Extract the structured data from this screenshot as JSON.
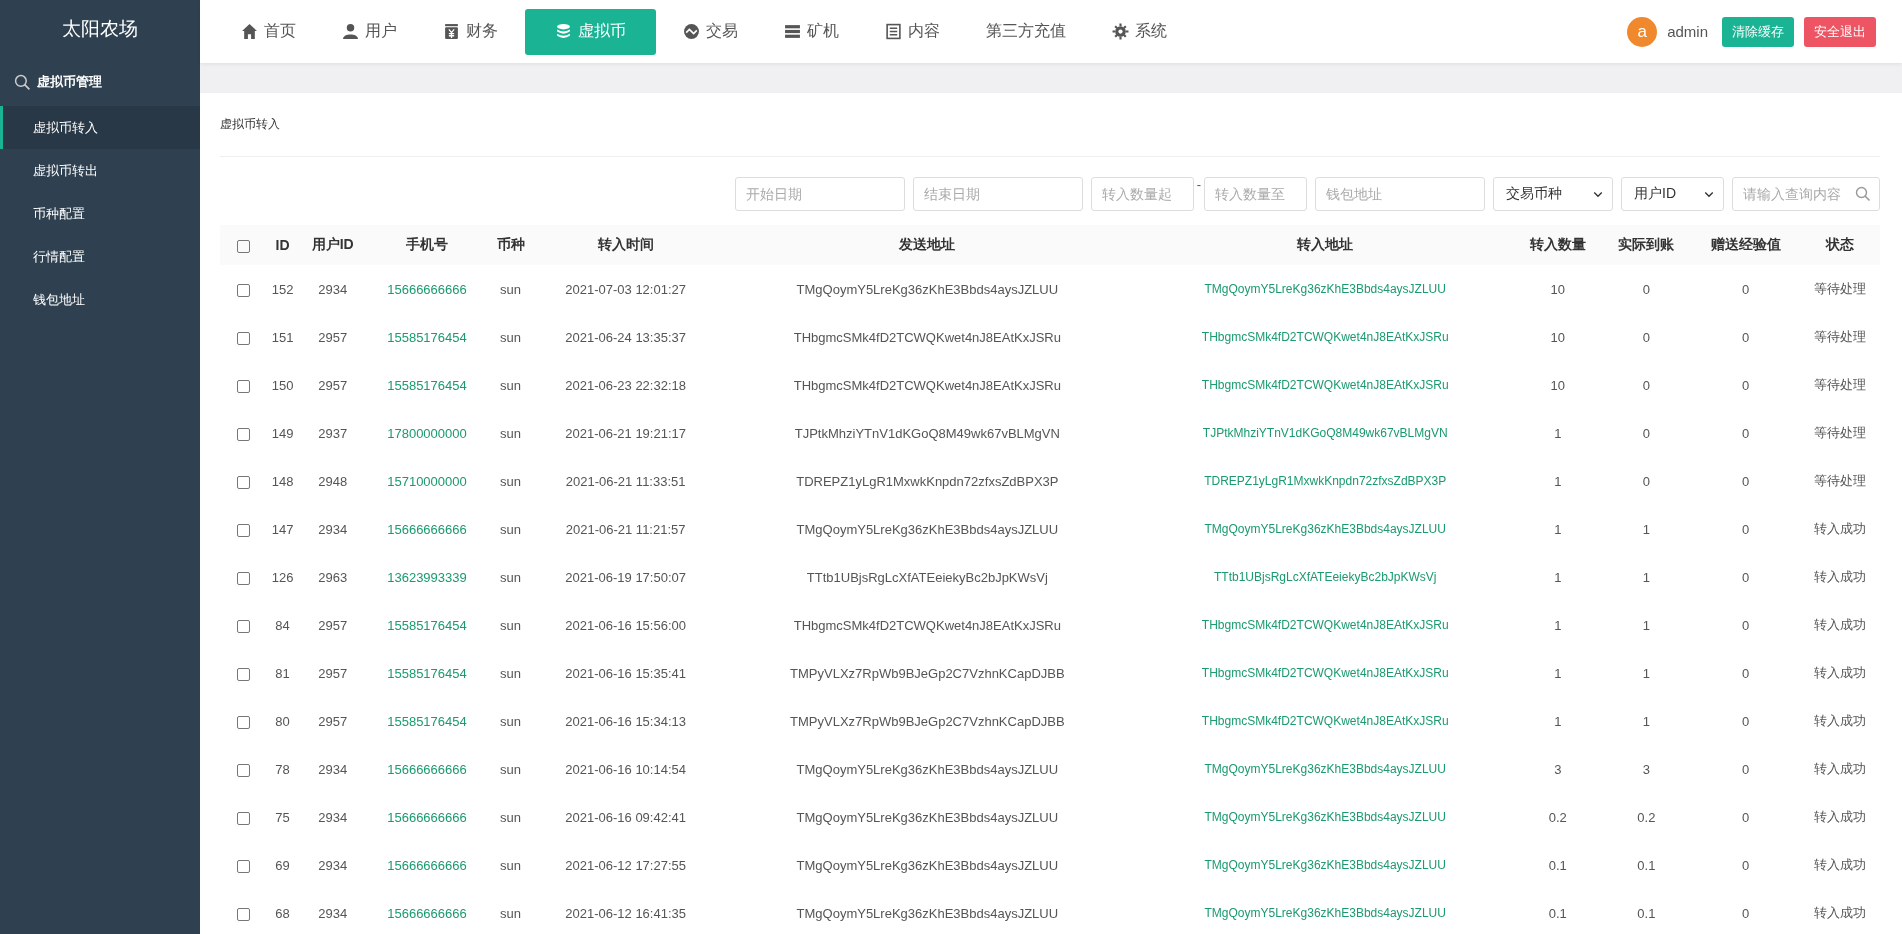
{
  "sidebar": {
    "brand": "太阳农场",
    "section": "虚拟币管理",
    "items": [
      {
        "label": "虚拟币转入",
        "selected": true
      },
      {
        "label": "虚拟币转出",
        "selected": false
      },
      {
        "label": "币种配置",
        "selected": false
      },
      {
        "label": "行情配置",
        "selected": false
      },
      {
        "label": "钱包地址",
        "selected": false
      }
    ]
  },
  "nav": {
    "items": [
      {
        "label": "首页",
        "selected": false
      },
      {
        "label": "用户",
        "selected": false
      },
      {
        "label": "财务",
        "selected": false
      },
      {
        "label": "虚拟币",
        "selected": true
      },
      {
        "label": "交易",
        "selected": false
      },
      {
        "label": "矿机",
        "selected": false
      },
      {
        "label": "内容",
        "selected": false
      },
      {
        "label": "第三方充值",
        "selected": false
      },
      {
        "label": "系统",
        "selected": false
      }
    ],
    "avatar": "a",
    "username": "admin",
    "buttons": [
      {
        "label": "清除缓存",
        "kind": "primary"
      },
      {
        "label": "安全退出",
        "kind": "danger"
      }
    ]
  },
  "panel": {
    "title": "虚拟币转入",
    "filters": [
      {
        "kind": "input",
        "placeholder": "开始日期"
      },
      {
        "kind": "input",
        "placeholder": "结束日期"
      },
      {
        "kind": "input",
        "placeholder": "转入数量起"
      },
      {
        "kind": "dash",
        "text": "-"
      },
      {
        "kind": "input",
        "placeholder": "转入数量至"
      },
      {
        "kind": "input",
        "placeholder": "钱包地址"
      },
      {
        "kind": "select",
        "value": "交易币种"
      },
      {
        "kind": "select",
        "value": "用户ID"
      },
      {
        "kind": "search",
        "placeholder": "请输入查询内容"
      }
    ],
    "table": {
      "all_checked": false,
      "columns": [
        "ID",
        "用户ID",
        "手机号",
        "币种",
        "转入时间",
        "发送地址",
        "转入地址",
        "转入数量",
        "实际到账",
        "赠送经验值",
        "状态"
      ],
      "rows": [
        {
          "checked": false,
          "cells": [
            "152",
            "2934",
            "15666666666",
            "sun",
            "2021-07-03 12:01:27",
            "TMgQoymY5LreKg36zKhE3Bbds4aysJZLUU",
            "TMgQoymY5LreKg36zKhE3Bbds4aysJZLUU",
            "10",
            "0",
            "0",
            "等待处理"
          ]
        },
        {
          "checked": false,
          "cells": [
            "151",
            "2957",
            "15585176454",
            "sun",
            "2021-06-24 13:35:37",
            "THbgmcSMk4fD2TCWQKwet4nJ8EAtKxJSRu",
            "THbgmcSMk4fD2TCWQKwet4nJ8EAtKxJSRu",
            "10",
            "0",
            "0",
            "等待处理"
          ]
        },
        {
          "checked": false,
          "cells": [
            "150",
            "2957",
            "15585176454",
            "sun",
            "2021-06-23 22:32:18",
            "THbgmcSMk4fD2TCWQKwet4nJ8EAtKxJSRu",
            "THbgmcSMk4fD2TCWQKwet4nJ8EAtKxJSRu",
            "10",
            "0",
            "0",
            "等待处理"
          ]
        },
        {
          "checked": false,
          "cells": [
            "149",
            "2937",
            "17800000000",
            "sun",
            "2021-06-21 19:21:17",
            "TJPtkMhziYTnV1dKGoQ8M49wk67vBLMgVN",
            "TJPtkMhziYTnV1dKGoQ8M49wk67vBLMgVN",
            "1",
            "0",
            "0",
            "等待处理"
          ]
        },
        {
          "checked": false,
          "cells": [
            "148",
            "2948",
            "15710000000",
            "sun",
            "2021-06-21 11:33:51",
            "TDREPZ1yLgR1MxwkKnpdn72zfxsZdBPX3P",
            "TDREPZ1yLgR1MxwkKnpdn72zfxsZdBPX3P",
            "1",
            "0",
            "0",
            "等待处理"
          ]
        },
        {
          "checked": false,
          "cells": [
            "147",
            "2934",
            "15666666666",
            "sun",
            "2021-06-21 11:21:57",
            "TMgQoymY5LreKg36zKhE3Bbds4aysJZLUU",
            "TMgQoymY5LreKg36zKhE3Bbds4aysJZLUU",
            "1",
            "1",
            "0",
            "转入成功"
          ]
        },
        {
          "checked": false,
          "cells": [
            "126",
            "2963",
            "13623993339",
            "sun",
            "2021-06-19 17:50:07",
            "TTtb1UBjsRgLcXfATEeiekyBc2bJpKWsVj",
            "TTtb1UBjsRgLcXfATEeiekyBc2bJpKWsVj",
            "1",
            "1",
            "0",
            "转入成功"
          ]
        },
        {
          "checked": false,
          "cells": [
            "84",
            "2957",
            "15585176454",
            "sun",
            "2021-06-16 15:56:00",
            "THbgmcSMk4fD2TCWQKwet4nJ8EAtKxJSRu",
            "THbgmcSMk4fD2TCWQKwet4nJ8EAtKxJSRu",
            "1",
            "1",
            "0",
            "转入成功"
          ]
        },
        {
          "checked": false,
          "cells": [
            "81",
            "2957",
            "15585176454",
            "sun",
            "2021-06-16 15:35:41",
            "TMPyVLXz7RpWb9BJeGp2C7VzhnKCapDJBB",
            "THbgmcSMk4fD2TCWQKwet4nJ8EAtKxJSRu",
            "1",
            "1",
            "0",
            "转入成功"
          ]
        },
        {
          "checked": false,
          "cells": [
            "80",
            "2957",
            "15585176454",
            "sun",
            "2021-06-16 15:34:13",
            "TMPyVLXz7RpWb9BJeGp2C7VzhnKCapDJBB",
            "THbgmcSMk4fD2TCWQKwet4nJ8EAtKxJSRu",
            "1",
            "1",
            "0",
            "转入成功"
          ]
        },
        {
          "checked": false,
          "cells": [
            "78",
            "2934",
            "15666666666",
            "sun",
            "2021-06-16 10:14:54",
            "TMgQoymY5LreKg36zKhE3Bbds4aysJZLUU",
            "TMgQoymY5LreKg36zKhE3Bbds4aysJZLUU",
            "3",
            "3",
            "0",
            "转入成功"
          ]
        },
        {
          "checked": false,
          "cells": [
            "75",
            "2934",
            "15666666666",
            "sun",
            "2021-06-16 09:42:41",
            "TMgQoymY5LreKg36zKhE3Bbds4aysJZLUU",
            "TMgQoymY5LreKg36zKhE3Bbds4aysJZLUU",
            "0.2",
            "0.2",
            "0",
            "转入成功"
          ]
        },
        {
          "checked": false,
          "cells": [
            "69",
            "2934",
            "15666666666",
            "sun",
            "2021-06-12 17:27:55",
            "TMgQoymY5LreKg36zKhE3Bbds4aysJZLUU",
            "TMgQoymY5LreKg36zKhE3Bbds4aysJZLUU",
            "0.1",
            "0.1",
            "0",
            "转入成功"
          ]
        },
        {
          "checked": false,
          "cells": [
            "68",
            "2934",
            "15666666666",
            "sun",
            "2021-06-12 16:41:35",
            "TMgQoymY5LreKg36zKhE3Bbds4aysJZLUU",
            "TMgQoymY5LreKg36zKhE3Bbds4aysJZLUU",
            "0.1",
            "0.1",
            "0",
            "转入成功"
          ]
        }
      ]
    }
  }
}
